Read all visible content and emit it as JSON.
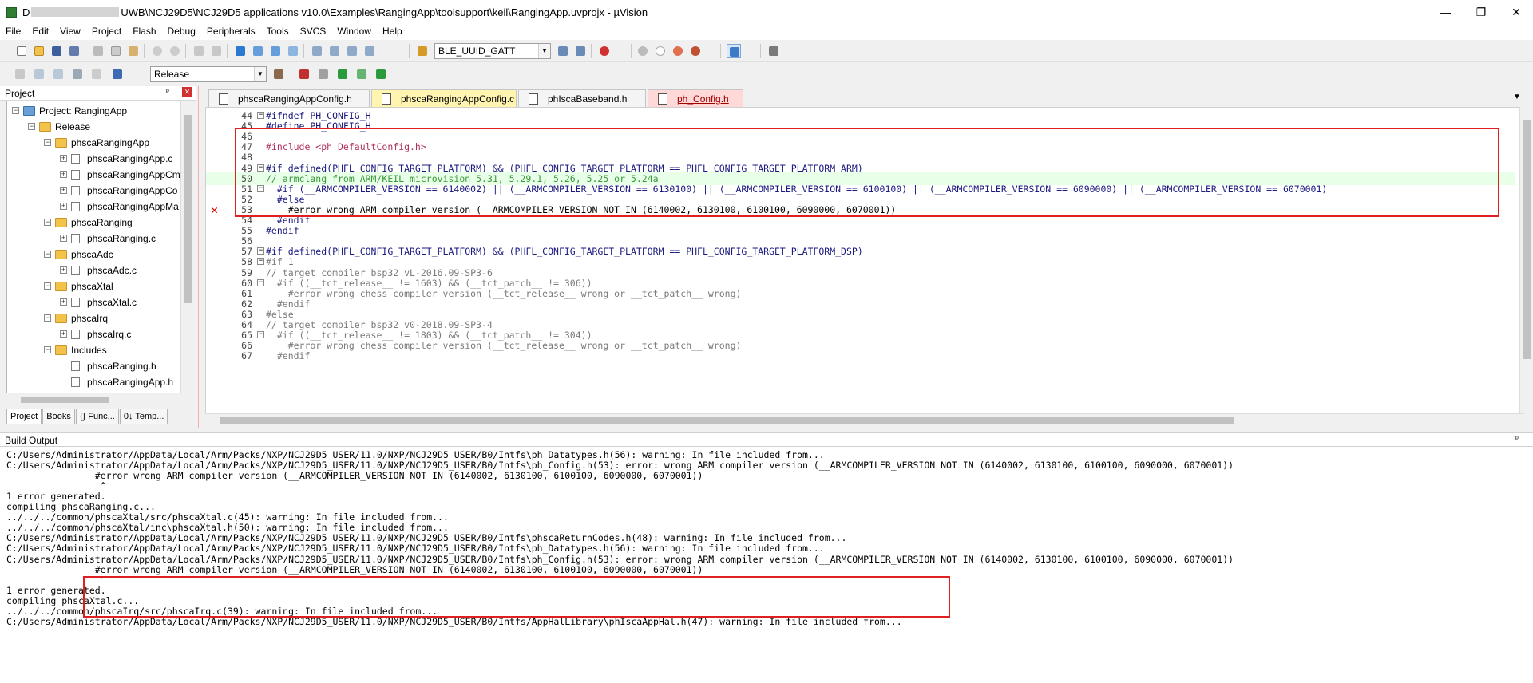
{
  "window": {
    "title_prefix": "D",
    "title": "UWB\\NCJ29D5\\NCJ29D5 applications v10.0\\Examples\\RangingApp\\toolsupport\\keil\\RangingApp.uvprojx - µVision",
    "minimize": "—",
    "restore": "❐",
    "close": "✕"
  },
  "menu": [
    "File",
    "Edit",
    "View",
    "Project",
    "Flash",
    "Debug",
    "Peripherals",
    "Tools",
    "SVCS",
    "Window",
    "Help"
  ],
  "toolbar": {
    "find_combo": "BLE_UUID_GATT",
    "target_combo": "Release"
  },
  "project_panel": {
    "title": "Project",
    "pin": "ᵖ",
    "close": "✕",
    "tree": [
      {
        "label": "Project: RangingApp",
        "level": 0,
        "type": "root",
        "exp": "−"
      },
      {
        "label": "Release",
        "level": 1,
        "type": "folder",
        "exp": "−"
      },
      {
        "label": "phscaRangingApp",
        "level": 2,
        "type": "folder",
        "exp": "−"
      },
      {
        "label": "phscaRangingApp.c",
        "level": 3,
        "type": "file",
        "exp": "+"
      },
      {
        "label": "phscaRangingAppCm",
        "level": 3,
        "type": "file",
        "exp": "+"
      },
      {
        "label": "phscaRangingAppCo",
        "level": 3,
        "type": "file",
        "exp": "+"
      },
      {
        "label": "phscaRangingAppMa",
        "level": 3,
        "type": "file",
        "exp": "+"
      },
      {
        "label": "phscaRanging",
        "level": 2,
        "type": "folder",
        "exp": "−"
      },
      {
        "label": "phscaRanging.c",
        "level": 3,
        "type": "file",
        "exp": "+"
      },
      {
        "label": "phscaAdc",
        "level": 2,
        "type": "folder",
        "exp": "−"
      },
      {
        "label": "phscaAdc.c",
        "level": 3,
        "type": "file",
        "exp": "+"
      },
      {
        "label": "phscaXtal",
        "level": 2,
        "type": "folder",
        "exp": "−"
      },
      {
        "label": "phscaXtal.c",
        "level": 3,
        "type": "file",
        "exp": "+"
      },
      {
        "label": "phscaIrq",
        "level": 2,
        "type": "folder",
        "exp": "−"
      },
      {
        "label": "phscaIrq.c",
        "level": 3,
        "type": "file",
        "exp": "+"
      },
      {
        "label": "Includes",
        "level": 2,
        "type": "folder",
        "exp": "−"
      },
      {
        "label": "phscaRanging.h",
        "level": 3,
        "type": "file",
        "exp": ""
      },
      {
        "label": "phscaRangingApp.h",
        "level": 3,
        "type": "file",
        "exp": ""
      }
    ],
    "tabs": [
      "Project",
      "Books",
      "{} Func...",
      "0↓ Temp..."
    ]
  },
  "editor": {
    "tabs": [
      {
        "label": "phscaRangingAppConfig.h",
        "style": "normal"
      },
      {
        "label": "phscaRangingAppConfig.c",
        "style": "active"
      },
      {
        "label": "phIscaBaseband.h",
        "style": "normal"
      },
      {
        "label": "ph_Config.h",
        "style": "modified"
      }
    ],
    "tab_menu": "▼",
    "lines": [
      {
        "n": "44",
        "fold": "−",
        "t": "#ifndef PH_CONFIG_H",
        "c": "c-dir"
      },
      {
        "n": "45",
        "fold": "",
        "t": "#define PH_CONFIG_H",
        "c": "c-dir"
      },
      {
        "n": "46",
        "fold": "",
        "t": "",
        "c": ""
      },
      {
        "n": "47",
        "fold": "",
        "t": "#include <ph_DefaultConfig.h>",
        "c": "c-inc"
      },
      {
        "n": "48",
        "fold": "",
        "t": "",
        "c": ""
      },
      {
        "n": "49",
        "fold": "−",
        "t": "#if defined(PHFL_CONFIG_TARGET_PLATFORM) && (PHFL_CONFIG_TARGET_PLATFORM == PHFL_CONFIG_TARGET_PLATFORM_ARM)",
        "c": "c-dir"
      },
      {
        "n": "50",
        "fold": "",
        "t": "// armclang from ARM/KEIL microvision 5.31, 5.29.1, 5.26, 5.25 or 5.24a",
        "c": "c-cmt",
        "hl": true
      },
      {
        "n": "51",
        "fold": "−",
        "t": "  #if (__ARMCOMPILER_VERSION == 6140002) || (__ARMCOMPILER_VERSION == 6130100) || (__ARMCOMPILER_VERSION == 6100100) || (__ARMCOMPILER_VERSION == 6090000) || (__ARMCOMPILER_VERSION == 6070001)",
        "c": "c-dir"
      },
      {
        "n": "52",
        "fold": "",
        "t": "  #else",
        "c": "c-dir"
      },
      {
        "n": "53",
        "fold": "",
        "t": "    #error wrong ARM compiler version (__ARMCOMPILER_VERSION NOT IN (6140002, 6130100, 6100100, 6090000, 6070001))",
        "c": "",
        "err": "✕"
      },
      {
        "n": "54",
        "fold": "",
        "t": "  #endif",
        "c": "c-dir"
      },
      {
        "n": "55",
        "fold": "",
        "t": "#endif",
        "c": "c-dir"
      },
      {
        "n": "56",
        "fold": "",
        "t": "",
        "c": ""
      },
      {
        "n": "57",
        "fold": "−",
        "t": "#if defined(PHFL_CONFIG_TARGET_PLATFORM) && (PHFL_CONFIG_TARGET_PLATFORM == PHFL_CONFIG_TARGET_PLATFORM_DSP)",
        "c": "c-dir"
      },
      {
        "n": "58",
        "fold": "−",
        "t": "#if 1",
        "c": "c-gray"
      },
      {
        "n": "59",
        "fold": "",
        "t": "// target compiler bsp32_vL-2016.09-SP3-6",
        "c": "c-gray"
      },
      {
        "n": "60",
        "fold": "−",
        "t": "  #if ((__tct_release__ != 1603) && (__tct_patch__ != 306))",
        "c": "c-gray"
      },
      {
        "n": "61",
        "fold": "",
        "t": "    #error wrong chess compiler version (__tct_release__ wrong or __tct_patch__ wrong)",
        "c": "c-gray"
      },
      {
        "n": "62",
        "fold": "",
        "t": "  #endif",
        "c": "c-gray"
      },
      {
        "n": "63",
        "fold": "",
        "t": "#else",
        "c": "c-gray"
      },
      {
        "n": "64",
        "fold": "",
        "t": "// target compiler bsp32_v0-2018.09-SP3-4",
        "c": "c-gray"
      },
      {
        "n": "65",
        "fold": "−",
        "t": "  #if ((__tct_release__ != 1803) && (__tct_patch__ != 304))",
        "c": "c-gray"
      },
      {
        "n": "66",
        "fold": "",
        "t": "    #error wrong chess compiler version (__tct_release__ wrong or __tct_patch__ wrong)",
        "c": "c-gray"
      },
      {
        "n": "67",
        "fold": "",
        "t": "  #endif",
        "c": "c-gray"
      }
    ]
  },
  "build_output": {
    "title": "Build Output",
    "pin": "ᵖ",
    "lines": [
      "C:/Users/Administrator/AppData/Local/Arm/Packs/NXP/NCJ29D5_USER/11.0/NXP/NCJ29D5_USER/B0/Intfs\\ph_Datatypes.h(56): warning: In file included from...",
      "C:/Users/Administrator/AppData/Local/Arm/Packs/NXP/NCJ29D5_USER/11.0/NXP/NCJ29D5_USER/B0/Intfs\\ph_Config.h(53): error: wrong ARM compiler version (__ARMCOMPILER_VERSION NOT IN (6140002, 6130100, 6100100, 6090000, 6070001))",
      "                #error wrong ARM compiler version (__ARMCOMPILER_VERSION NOT IN (6140002, 6130100, 6100100, 6090000, 6070001))",
      "                 ^",
      "1 error generated.",
      "compiling phscaRanging.c...",
      "../../../common/phscaXtal/src/phscaXtal.c(45): warning: In file included from...",
      "../../../common/phscaXtal/inc\\phscaXtal.h(50): warning: In file included from...",
      "C:/Users/Administrator/AppData/Local/Arm/Packs/NXP/NCJ29D5_USER/11.0/NXP/NCJ29D5_USER/B0/Intfs\\phscaReturnCodes.h(48): warning: In file included from...",
      "C:/Users/Administrator/AppData/Local/Arm/Packs/NXP/NCJ29D5_USER/11.0/NXP/NCJ29D5_USER/B0/Intfs\\ph_Datatypes.h(56): warning: In file included from...",
      "C:/Users/Administrator/AppData/Local/Arm/Packs/NXP/NCJ29D5_USER/11.0/NXP/NCJ29D5_USER/B0/Intfs\\ph_Config.h(53): error: wrong ARM compiler version (__ARMCOMPILER_VERSION NOT IN (6140002, 6130100, 6100100, 6090000, 6070001))",
      "                #error wrong ARM compiler version (__ARMCOMPILER_VERSION NOT IN (6140002, 6130100, 6100100, 6090000, 6070001))",
      "                 ^",
      "1 error generated.",
      "compiling phscaXtal.c...",
      "../../../common/phscaIrq/src/phscaIrq.c(39): warning: In file included from...",
      "C:/Users/Administrator/AppData/Local/Arm/Packs/NXP/NCJ29D5_USER/11.0/NXP/NCJ29D5_USER/B0/Intfs/AppHalLibrary\\phIscaAppHal.h(47): warning: In file included from..."
    ]
  },
  "colors": {
    "annotation": "#e02020",
    "highlight_line": "#e8ffe8",
    "active_tab": "#fff4b0",
    "modified_tab": "#ffd8d8"
  }
}
